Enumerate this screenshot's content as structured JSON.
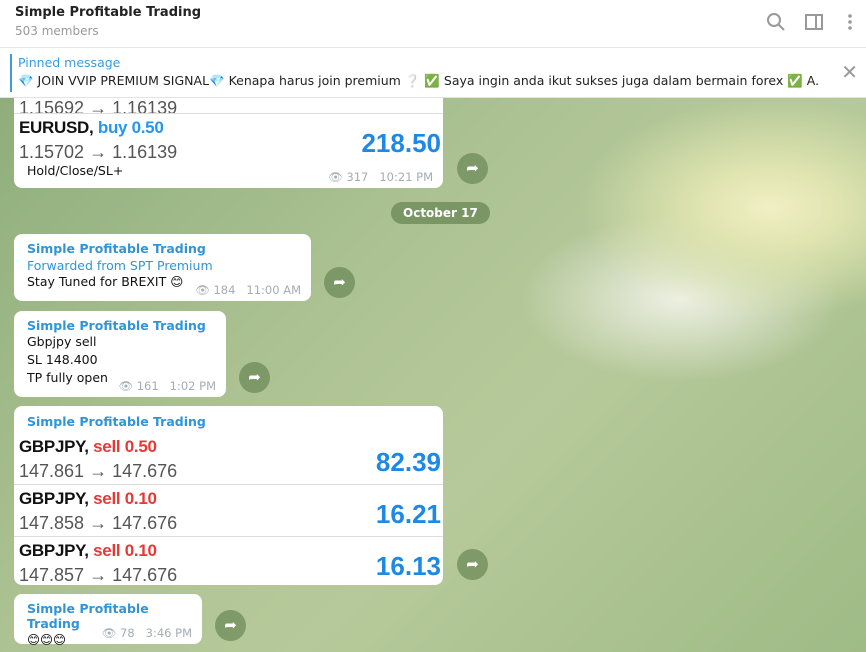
{
  "header": {
    "title": "Simple Profitable Trading",
    "members": "503 members"
  },
  "pinned": {
    "label": "Pinned message",
    "text": "💎 JOIN VVIP PREMIUM SIGNAL💎  Kenapa harus join premium ❔ ✅ Saya ingin anda ikut sukses juga dalam bermain forex ✅ A..."
  },
  "messages": {
    "m1": {
      "partial_prices": "1.15692 → 1.16139",
      "pair": "EURUSD,",
      "side": "buy 0.50",
      "prices": "1.15702 → 1.16139",
      "profit": "218.50",
      "caption": "Hold/Close/SL+",
      "views": "317",
      "time": "10:21 PM"
    },
    "date": "October 17",
    "m2": {
      "sender": "Simple Profitable Trading",
      "forwarded": "Forwarded from SPT Premium",
      "text": "Stay Tuned for BREXIT 😊",
      "views": "184",
      "time": "11:00 AM"
    },
    "m3": {
      "sender": "Simple Profitable Trading",
      "lines": [
        "Gbpjpy  sell",
        "SL 148.400",
        "TP fully open"
      ],
      "views": "161",
      "time": "1:02 PM"
    },
    "m4": {
      "sender": "Simple Profitable Trading",
      "trades": [
        {
          "pair": "GBPJPY,",
          "side": "sell 0.50",
          "prices": "147.861 → 147.676",
          "profit": "82.39"
        },
        {
          "pair": "GBPJPY,",
          "side": "sell 0.10",
          "prices": "147.858 → 147.676",
          "profit": "16.21"
        },
        {
          "pair": "GBPJPY,",
          "side": "sell 0.10",
          "prices": "147.857 → 147.676",
          "profit": "16.13"
        }
      ]
    },
    "m5": {
      "sender": "Simple Profitable Trading",
      "text": "😊😊😊",
      "views": "78",
      "time": "3:46 PM"
    }
  }
}
